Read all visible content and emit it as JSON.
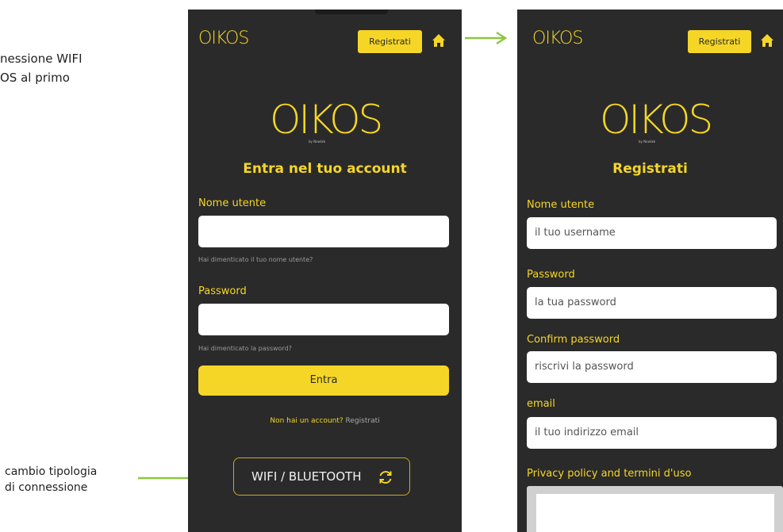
{
  "doc": {
    "left_line1": "nessione WIFI",
    "left_line2": "OS al primo",
    "caption_line1": "cambio tipologia",
    "caption_line2": "di connessione"
  },
  "colors": {
    "accent": "#f5d627",
    "screen_bg": "#2a2a2a",
    "arrow": "#8dc63f"
  },
  "login": {
    "logo_small": "OIKOS",
    "header_button": "Registrati",
    "logo_big": "OIKOS",
    "byline": "by Nowlab",
    "title": "Entra nel tuo account",
    "username_label": "Nome utente",
    "username_hint": "Hai dimenticato il tuo nome utente?",
    "password_label": "Password",
    "password_hint": "Hai dimenticato la password?",
    "submit": "Entra",
    "no_account": "Non hai un account?",
    "register_link": "Registrati",
    "connection_button": "WIFI / BLUETOOTH",
    "icons": [
      "home-icon",
      "refresh-icon"
    ]
  },
  "register": {
    "logo_small": "OIKOS",
    "header_button": "Registrati",
    "logo_big": "OIKOS",
    "byline": "by Nowlab",
    "title": "Registrati",
    "username_label": "Nome utente",
    "username_placeholder": "il tuo username",
    "password_label": "Password",
    "password_placeholder": "la tua password",
    "confirm_label": "Confirm password",
    "confirm_placeholder": "riscrivi la password",
    "email_label": "email",
    "email_placeholder": "il tuo indirizzo email",
    "privacy_label": "Privacy policy and termini d'uso"
  }
}
